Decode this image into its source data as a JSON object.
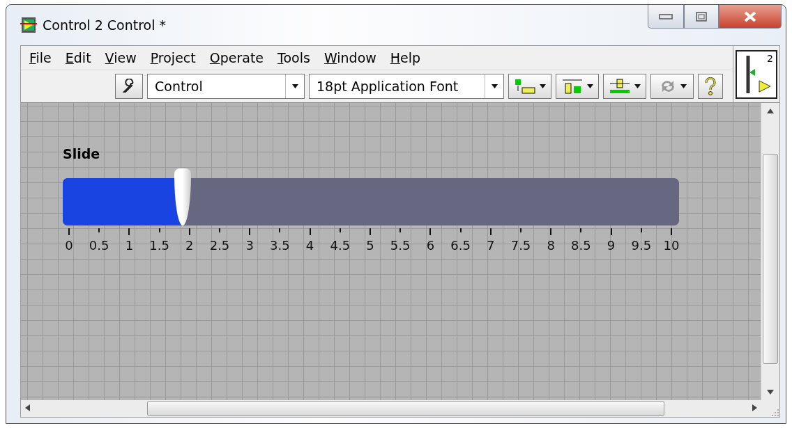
{
  "window": {
    "title": "Control 2 Control *"
  },
  "menu": [
    {
      "label": "File"
    },
    {
      "label": "Edit"
    },
    {
      "label": "View"
    },
    {
      "label": "Project"
    },
    {
      "label": "Operate"
    },
    {
      "label": "Tools"
    },
    {
      "label": "Window"
    },
    {
      "label": "Help"
    }
  ],
  "toolbar": {
    "control_dropdown": "Control",
    "font_dropdown": "18pt Application Font"
  },
  "connector_pane": {
    "count": "2"
  },
  "slider": {
    "label": "Slide",
    "level": 0.19,
    "scale": [
      "0",
      "0.5",
      "1",
      "1.5",
      "2",
      "2.5",
      "3",
      "3.5",
      "4",
      "4.5",
      "5",
      "5.5",
      "6",
      "6.5",
      "7",
      "7.5",
      "8",
      "8.5",
      "9",
      "9.5",
      "10"
    ]
  }
}
